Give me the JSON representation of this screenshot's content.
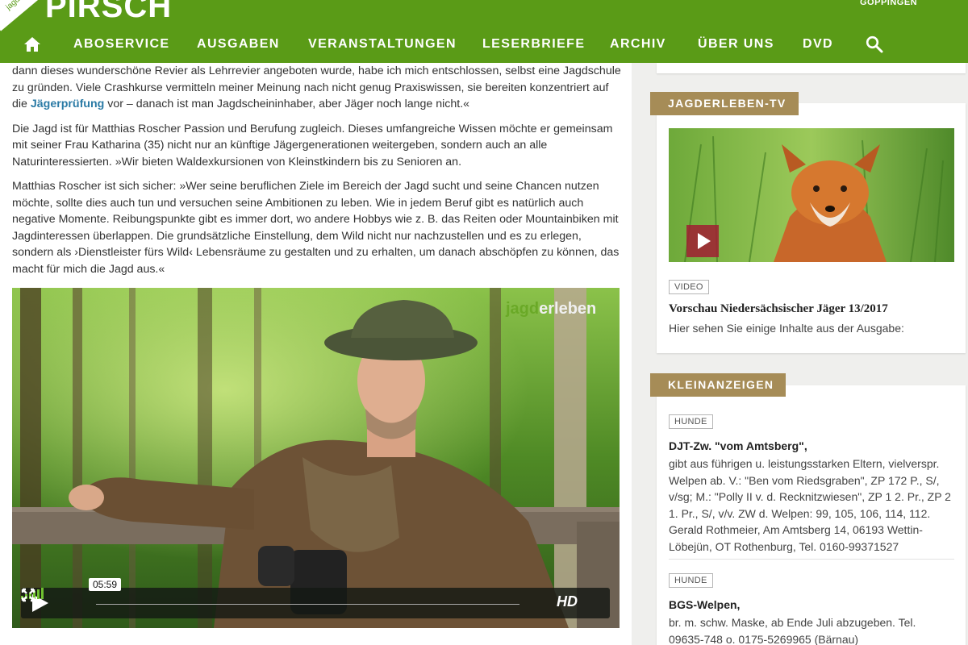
{
  "header": {
    "corner_label": "jagd",
    "logo": "PIRSCH",
    "city": "GÖPPINGEN",
    "nav": [
      "ABOSERVICE",
      "AUSGABEN",
      "VERANSTALTUNGEN",
      "LESERBRIEFE",
      "ARCHIV",
      "ÜBER UNS",
      "DVD"
    ],
    "home_icon": "home-icon",
    "search_icon": "search-icon",
    "brand_color": "#5a9b17"
  },
  "article": {
    "p1_a": "dann dieses wunderschöne Revier als Lehrrevier angeboten wurde, habe ich mich entschlossen, selbst eine Jagdschule zu gründen. Viele Crashkurse vermitteln meiner Meinung nach nicht genug Praxiswissen, sie bereiten konzentriert auf die ",
    "p1_link": "Jägerprüfung",
    "p1_b": " vor – danach ist man Jagdscheininhaber, aber Jäger noch lange nicht.«",
    "p2": "Die Jagd ist für Matthias Roscher Passion und Berufung zugleich. Dieses umfangreiche Wissen möchte er gemeinsam mit seiner Frau Katharina (35) nicht nur an künftige Jägergenerationen weitergeben, sondern auch an alle Naturinteressierten. »Wir bieten Waldexkursionen von Kleinstkindern bis zu Senioren an.",
    "p3": "Matthias Roscher ist sich sicher: »Wer seine beruflichen Ziele im Bereich der Jagd sucht und seine Chancen nutzen möchte, sollte dies auch tun und versuchen seine Ambitionen zu leben. Wie in jedem Beruf gibt es natürlich auch negative Momente. Reibungspunkte gibt es immer dort, wo andere Hobbys wie z. B. das Reiten oder Mountainbiken mit Jagdinteressen überlappen. Die grundsätzliche Einstellung, dem Wild nicht nur nachzustellen und es zu erlegen, sondern als ›Dienstleister fürs Wild‹ Lebensräume zu gestalten und zu erhalten, um danach abschöpfen zu können, das macht für mich die Jagd aus.«",
    "link_color": "#2a7aa5"
  },
  "video": {
    "brand_part1": "jagd",
    "brand_part2": "erleben",
    "time": "05:59",
    "hd_label": "HD",
    "play_icon": "play-icon",
    "fullscreen_icon": "fullscreen-icon",
    "volume_icon": "volume-bars-icon"
  },
  "sidebar": {
    "tv": {
      "tag": "JAGDERLEBEN-TV",
      "badge": "VIDEO",
      "title": "Vorschau Niedersächsischer Jäger 13/2017",
      "desc": "Hier sehen Sie einige Inhalte aus der Ausgabe:"
    },
    "ads": {
      "tag": "KLEINANZEIGEN",
      "items": [
        {
          "badge": "HUNDE",
          "title": "DJT-Zw. \"vom Amtsberg\",",
          "text": "gibt aus führigen u. leistungsstarken Eltern, vielverspr. Welpen ab. V.: \"Ben vom Riedsgraben\", ZP 172 P., S/, v/sg; M.: \"Polly II v. d. Recknitzwiesen\", ZP 1 2. Pr., ZP 2 1. Pr., S/, v/v. ZW d. Welpen: 99, 105, 106, 114, 112. Gerald Rothmeier, Am Amtsberg 14, 06193 Wettin-Löbejün, OT Rothenburg, Tel. 0160-99371527"
        },
        {
          "badge": "HUNDE",
          "title": "BGS-Welpen,",
          "text": "br. m. schw. Maske, ab Ende Juli abzugeben. Tel. 09635-748 o. 0175-5269965 (Bärnau)"
        }
      ]
    },
    "tag_color": "#a68c57"
  }
}
